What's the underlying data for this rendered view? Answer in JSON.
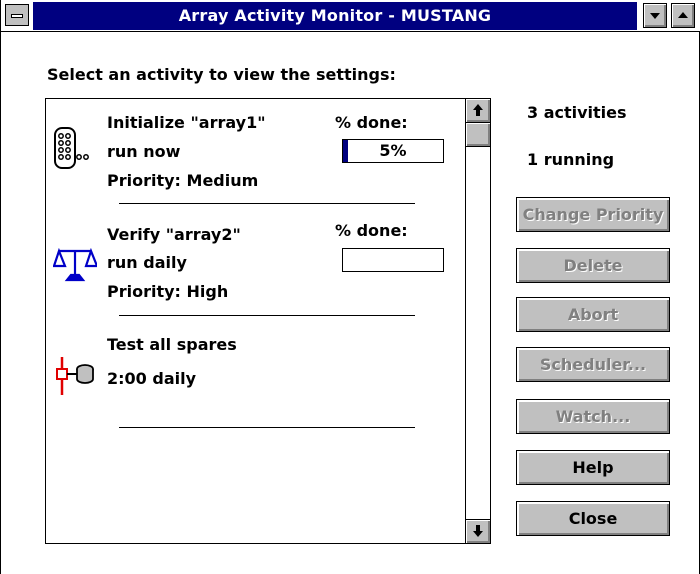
{
  "window": {
    "title": "Array Activity Monitor - MUSTANG"
  },
  "prompt": "Select an activity to view the settings:",
  "activities": [
    {
      "name": "Initialize \"array1\"",
      "schedule": "run now",
      "priority": "Priority: Medium",
      "percent_label": "% done:",
      "progress": 5,
      "progress_text": "5%",
      "icon": "disk-array-icon"
    },
    {
      "name": "Verify  \"array2\"",
      "schedule": "run daily",
      "priority": "Priority: High",
      "percent_label": "% done:",
      "progress": 0,
      "progress_text": "",
      "icon": "balance-scale-icon"
    },
    {
      "name": "Test all spares",
      "schedule": "2:00 daily",
      "icon": "spare-disk-test-icon"
    }
  ],
  "status": {
    "activities": "3 activities",
    "running": "1 running"
  },
  "buttons": {
    "change_priority": "Change Priority",
    "delete": "Delete",
    "abort": "Abort",
    "scheduler": "Scheduler...",
    "watch": "Watch...",
    "help": "Help",
    "close": "Close"
  },
  "colors": {
    "title_bar": "#000080",
    "progress_fill": "#000080",
    "button_face": "#c0c0c0",
    "disabled_text": "#808080"
  }
}
